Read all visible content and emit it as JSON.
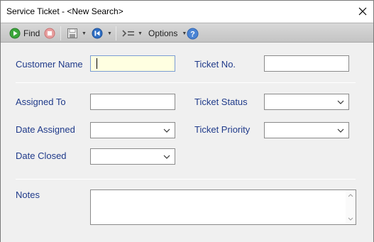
{
  "window": {
    "title": "Service Ticket - <New Search>"
  },
  "toolbar": {
    "find_label": "Find",
    "options_label": "Options"
  },
  "form": {
    "customer_name_label": "Customer Name",
    "customer_name_value": "",
    "ticket_no_label": "Ticket No.",
    "ticket_no_value": "",
    "assigned_to_label": "Assigned To",
    "assigned_to_value": "",
    "ticket_status_label": "Ticket Status",
    "ticket_status_value": "",
    "date_assigned_label": "Date Assigned",
    "date_assigned_value": "",
    "ticket_priority_label": "Ticket Priority",
    "ticket_priority_value": "",
    "date_closed_label": "Date Closed",
    "date_closed_value": "",
    "notes_label": "Notes",
    "notes_value": ""
  },
  "colors": {
    "label_text": "#1f3a8a",
    "focused_field_bg": "#ffffe1",
    "find_icon": "#3aa63a",
    "stop_icon": "#e06060",
    "nav_icon": "#2f6fc4",
    "help_icon": "#4a84d4"
  },
  "icons": {
    "close": "close-icon",
    "find": "play-icon",
    "stop": "stop-icon",
    "save": "save-icon",
    "navigate": "rewind-icon",
    "indent": "indent-icon",
    "help": "help-icon",
    "dropdown": "chevron-down-icon"
  }
}
